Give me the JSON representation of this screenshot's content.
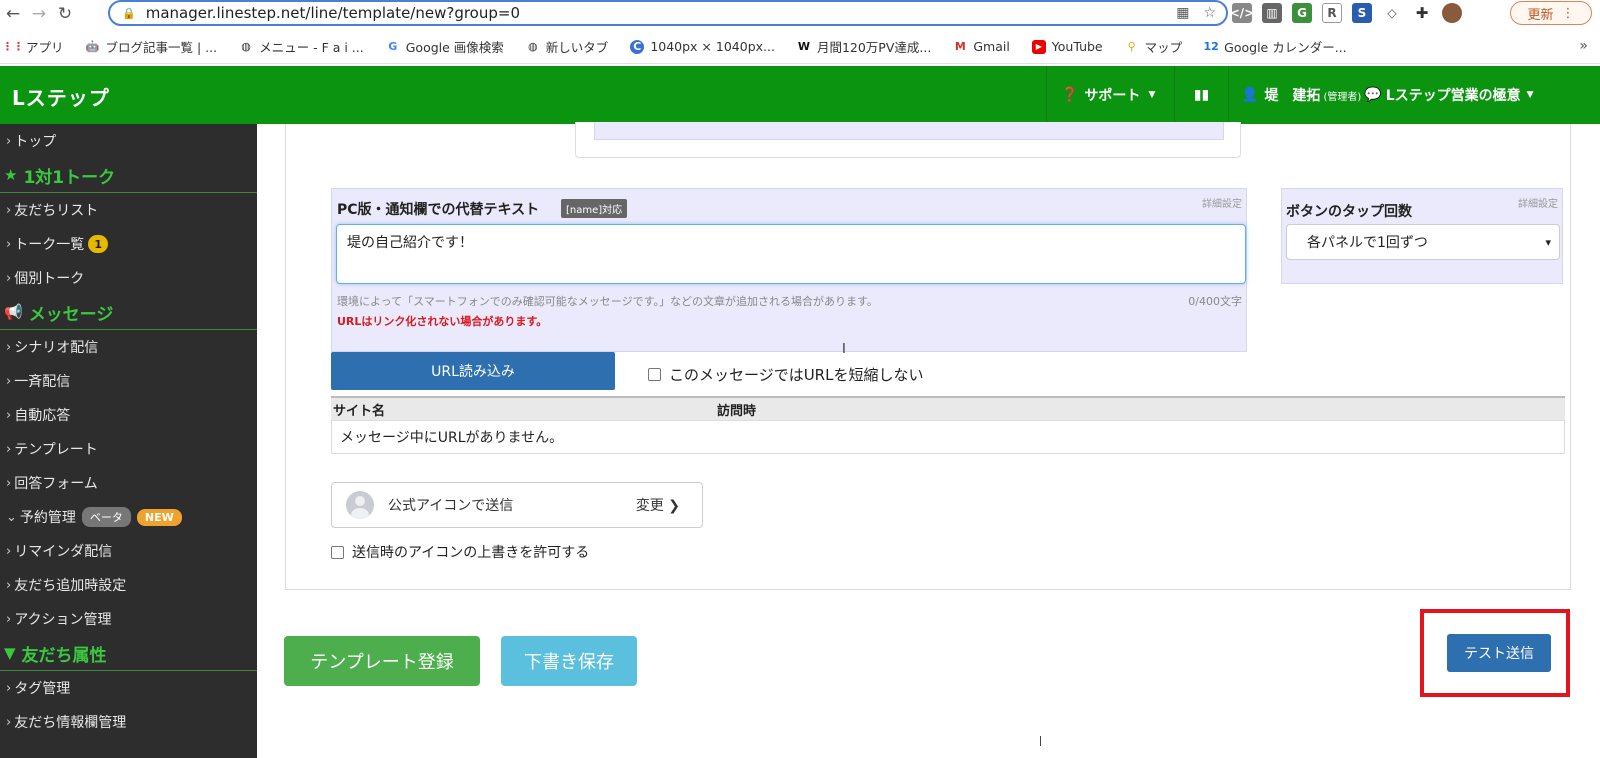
{
  "browser": {
    "url": "manager.linestep.net/line/template/new?group=0",
    "update_label": "更新",
    "bookmarks": [
      {
        "label": "アプリ",
        "icon": "apps-grid-icon"
      },
      {
        "label": "ブログ記事一覧 | ...",
        "icon": "android-icon"
      },
      {
        "label": "メニュー - F a i ...",
        "icon": "globe-icon"
      },
      {
        "label": "Google 画像検索",
        "icon": "google-icon"
      },
      {
        "label": "新しいタブ",
        "icon": "globe-icon"
      },
      {
        "label": "1040px × 1040px...",
        "icon": "circle-c-icon"
      },
      {
        "label": "月間120万PV達成...",
        "icon": "w-icon"
      },
      {
        "label": "Gmail",
        "icon": "gmail-icon"
      },
      {
        "label": "YouTube",
        "icon": "youtube-icon"
      },
      {
        "label": "マップ",
        "icon": "maps-pin-icon"
      },
      {
        "label": "Google カレンダー...",
        "icon": "calendar-icon"
      }
    ],
    "more": "»"
  },
  "header": {
    "brand": "Lステップ",
    "support": "サポート",
    "user_name": "堤　建拓",
    "user_role": "(管理者)",
    "account": "Lステップ営業の極意"
  },
  "sidebar": {
    "items": [
      {
        "type": "link",
        "label": "トップ"
      },
      {
        "type": "section",
        "label": "1対1トーク",
        "icon": "star-icon"
      },
      {
        "type": "link",
        "label": "友だちリスト"
      },
      {
        "type": "link",
        "label": "トーク一覧",
        "count": "1"
      },
      {
        "type": "link",
        "label": "個別トーク"
      },
      {
        "type": "section",
        "label": "メッセージ",
        "icon": "megaphone-icon"
      },
      {
        "type": "link",
        "label": "シナリオ配信"
      },
      {
        "type": "link",
        "label": "一斉配信"
      },
      {
        "type": "link",
        "label": "自動応答"
      },
      {
        "type": "link",
        "label": "テンプレート"
      },
      {
        "type": "link",
        "label": "回答フォーム"
      },
      {
        "type": "link-open",
        "label": "予約管理",
        "beta": "ベータ",
        "new": "NEW"
      },
      {
        "type": "link",
        "label": "リマインダ配信"
      },
      {
        "type": "link",
        "label": "友だち追加時設定"
      },
      {
        "type": "link",
        "label": "アクション管理"
      },
      {
        "type": "section",
        "label": "友だち属性",
        "icon": "filter-icon"
      },
      {
        "type": "link",
        "label": "タグ管理"
      },
      {
        "type": "link",
        "label": "友だち情報欄管理"
      }
    ]
  },
  "form": {
    "alt_title": "PC版・通知欄での代替テキスト",
    "name_tag": "[name]対応",
    "detail_link": "詳細設定",
    "alt_value": "堤の自己紹介です！",
    "hint": "環境によって「スマートフォンでのみ確認可能なメッセージです。」などの文章が追加される場合があります。",
    "counter": "0/400文字",
    "warning": "URLはリンク化されない場合があります。",
    "tap_title": "ボタンのタップ回数",
    "tap_detail": "詳細設定",
    "tap_value": "各パネルで1回ずつ",
    "url_load": "URL読み込み",
    "no_shorten": "このメッセージではURLを短縮しない",
    "table_headers": [
      "サイト名",
      "訪問時"
    ],
    "table_empty": "メッセージ中にURLがありません。",
    "icon_send_label": "公式アイコンで送信",
    "icon_change": "変更",
    "override_label": "送信時のアイコンの上書きを許可する"
  },
  "actions": {
    "register": "テンプレート登録",
    "draft": "下書き保存",
    "test_send": "テスト送信"
  },
  "colors": {
    "brand_green": "#0a9410",
    "sidebar_bg": "#2d2d2d",
    "section_green": "#39c93f",
    "primary_blue": "#2e6fb0",
    "success_green": "#4cae4c",
    "info_cyan": "#5bc0de",
    "highlight_red": "#e3141d"
  }
}
